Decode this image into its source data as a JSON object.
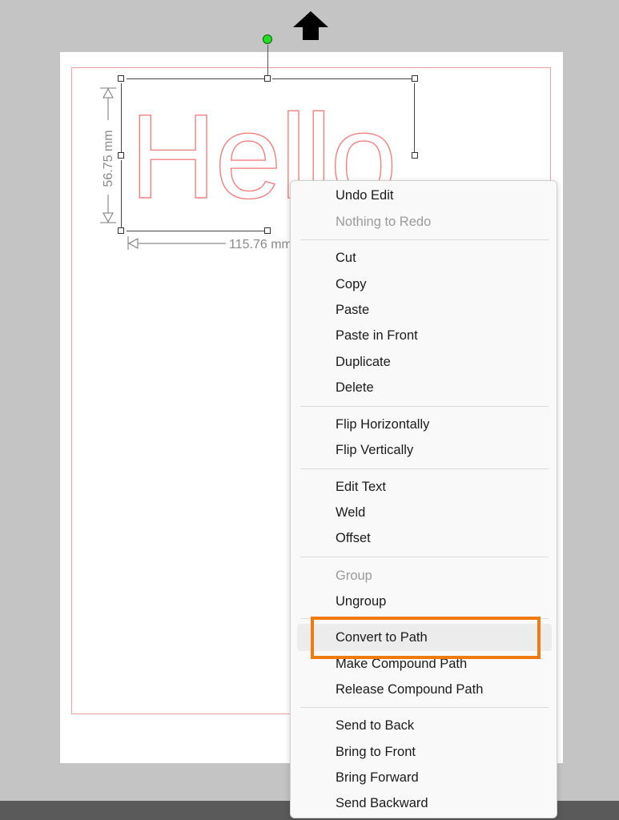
{
  "canvas": {
    "text_object": "Hello",
    "width_dimension": "115.76 mm",
    "height_dimension": "56.75 mm"
  },
  "colors": {
    "outline": "#f0a0a0",
    "highlight": "#ef7b10",
    "rotate_handle": "#22dd22"
  },
  "icons": {
    "move_arrow": "up-arrow-icon",
    "rotate_handle": "rotate-handle-icon"
  },
  "context_menu": {
    "undo_edit": "Undo Edit",
    "nothing_to_redo": "Nothing to Redo",
    "cut": "Cut",
    "copy": "Copy",
    "paste": "Paste",
    "paste_in_front": "Paste in Front",
    "duplicate": "Duplicate",
    "delete": "Delete",
    "flip_horizontally": "Flip Horizontally",
    "flip_vertically": "Flip Vertically",
    "edit_text": "Edit Text",
    "weld": "Weld",
    "offset": "Offset",
    "group": "Group",
    "ungroup": "Ungroup",
    "convert_to_path": "Convert to Path",
    "make_compound_path": "Make Compound Path",
    "release_compound_path": "Release Compound Path",
    "send_to_back": "Send to Back",
    "bring_to_front": "Bring to Front",
    "bring_forward": "Bring Forward",
    "send_backward": "Send Backward"
  }
}
